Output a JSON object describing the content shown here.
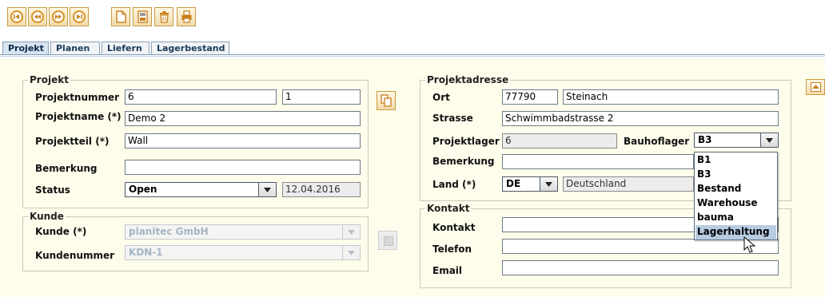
{
  "toolbar": {
    "buttons": [
      {
        "name": "first-record-icon",
        "glyph": "|◂"
      },
      {
        "name": "previous-record-icon",
        "glyph": "◂◂"
      },
      {
        "name": "next-record-icon",
        "glyph": "▸▸"
      },
      {
        "name": "last-record-icon",
        "glyph": "▸|"
      },
      {
        "name": "new-document-icon",
        "glyph": "doc"
      },
      {
        "name": "save-icon",
        "glyph": "save"
      },
      {
        "name": "delete-icon",
        "glyph": "trash"
      },
      {
        "name": "print-icon",
        "glyph": "print"
      }
    ]
  },
  "tabs": [
    {
      "label": "Projekt",
      "active": true
    },
    {
      "label": "Planen",
      "active": false
    },
    {
      "label": "Liefern",
      "active": false
    },
    {
      "label": "Lagerbestand",
      "active": false
    }
  ],
  "projekt": {
    "title": "Projekt",
    "projektnummer_label": "Projektnummer",
    "projektnummer_value": "6",
    "projektnummer_sub": "1",
    "projektname_label": "Projektname (*)",
    "projektname_value": "Demo 2",
    "projektteil_label": "Projektteil (*)",
    "projektteil_value": "Wall",
    "bemerkung_label": "Bemerkung",
    "bemerkung_value": "",
    "status_label": "Status",
    "status_value": "Open",
    "status_date": "12.04.2016"
  },
  "kunde": {
    "title": "Kunde",
    "kunde_label": "Kunde (*)",
    "kunde_value": "planitec GmbH",
    "kundennummer_label": "Kundenummer",
    "kundennummer_value": "KDN-1"
  },
  "projektadresse": {
    "title": "Projektadresse",
    "ort_label": "Ort",
    "plz_value": "77790",
    "ort_value": "Steinach",
    "strasse_label": "Strasse",
    "strasse_value": "Schwimmbadstrasse 2",
    "projektlager_label": "Projektlager",
    "projektlager_value": "6",
    "bauhoflager_label": "Bauhoflager",
    "bauhoflager_value": "B3",
    "bemerkung_label": "Bemerkung",
    "bemerkung_value": "",
    "land_label": "Land (*)",
    "land_code": "DE",
    "land_name": "Deutschland"
  },
  "bauhoflager_dropdown": {
    "options": [
      "B1",
      "B3",
      "Bestand",
      "Warehouse",
      "bauma",
      "Lagerhaltung"
    ],
    "highlighted_index": 5
  },
  "kontakt": {
    "title": "Kontakt",
    "kontakt_label": "Kontakt",
    "kontakt_value": "",
    "telefon_label": "Telefon",
    "telefon_value": "",
    "email_label": "Email",
    "email_value": ""
  },
  "colors": {
    "panel_bg": "#fefcea",
    "button_accent": "#d6921e",
    "tab_active_bg": "#d8e4ef",
    "selection": "#b7cbe1"
  }
}
